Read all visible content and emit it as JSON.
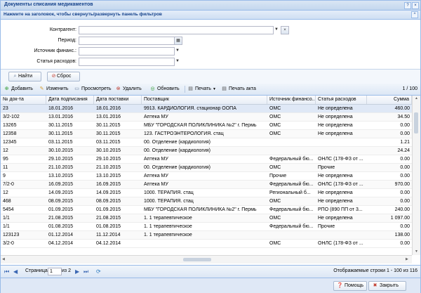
{
  "window": {
    "title": "Документы списания медикаментов",
    "btn_help": "?",
    "btn_close": "×"
  },
  "filter_panel": {
    "header": "Нажмите на заголовок, чтобы свернуть/развернуть панель фильтров",
    "collapse_icon": "^",
    "fields": [
      {
        "label": "Контрагент:",
        "value": ""
      },
      {
        "label": "Период:",
        "value": ""
      },
      {
        "label": "Источник финанс.:",
        "value": ""
      },
      {
        "label": "Статья расходов:",
        "value": ""
      }
    ]
  },
  "actions": {
    "find": "Найти",
    "reset": "Сброс"
  },
  "toolbar": {
    "add": "Добавить",
    "edit": "Изменить",
    "view": "Просмотреть",
    "delete": "Удалить",
    "refresh": "Обновить",
    "print": "Печать",
    "print_act": "Печать акта",
    "page_indicator": "1 / 100"
  },
  "grid": {
    "columns": [
      "№ док-та",
      "Дата подписания",
      "Дата поставки",
      "Поставщик",
      "Источник финансо...",
      "Статья расходов",
      "Сумма"
    ],
    "rows": [
      [
        "23",
        "18.01.2016",
        "18.01.2016",
        "9913. КАРДИОЛОГИЯ. стационар ООПА",
        "ОМС",
        "Не определена",
        "460.00"
      ],
      [
        "3/2-102",
        "13.01.2016",
        "13.01.2016",
        "Аптека МУ",
        "ОМС",
        "Не определена",
        "34.50"
      ],
      [
        "13265",
        "30.11.2015",
        "30.11.2015",
        "МБУ \"ГОРОДСКАЯ ПОЛИКЛИНИКА №2\" г. Пермь",
        "ОМС",
        "Не определена",
        "0.00"
      ],
      [
        "12358",
        "30.11.2015",
        "30.11.2015",
        "123. ГАСТРОЭНТЕРОЛОГИЯ. стац",
        "ОМС",
        "Не определена",
        "0.00"
      ],
      [
        "12345",
        "03.11.2015",
        "03.11.2015",
        "00. Отделение (кардиология)",
        "",
        "",
        "1.21"
      ],
      [
        "12",
        "30.10.2015",
        "30.10.2015",
        "00. Отделение (кардиология)",
        "",
        "",
        "24.24"
      ],
      [
        "95",
        "29.10.2015",
        "29.10.2015",
        "Аптека МУ",
        "Федеральный бю...",
        "ОНЛС (178-ФЗ от ...",
        "0.00"
      ],
      [
        "11",
        "21.10.2015",
        "21.10.2015",
        "00. Отделение (кардиология)",
        "ОМС",
        "Прочие",
        "0.00"
      ],
      [
        "9",
        "13.10.2015",
        "13.10.2015",
        "Аптека МУ",
        "Прочие",
        "Не определена",
        "0.00"
      ],
      [
        "7/2-0",
        "16.09.2015",
        "16.09.2015",
        "Аптека МУ",
        "Федеральный бю...",
        "ОНЛС (178-ФЗ от ...",
        "970.00"
      ],
      [
        "12",
        "14.09.2015",
        "14.09.2015",
        "1000. ТЕРАПИЯ. стац",
        "Региональный б...",
        "Не определена",
        "0.00"
      ],
      [
        "468",
        "08.09.2015",
        "08.09.2015",
        "1000. ТЕРАПИЯ. стац",
        "ОМС",
        "Не определена",
        "0.00"
      ],
      [
        "5454",
        "01.09.2015",
        "01.09.2015",
        "МБУ \"ГОРОДСКАЯ ПОЛИКЛИНИКА №2\" г. Пермь",
        "Федеральный бю...",
        "РПО (890 ПП от 3...",
        "240.00"
      ],
      [
        "1/1",
        "21.08.2015",
        "21.08.2015",
        "1. 1 терапевтическое",
        "ОМС",
        "Не определена",
        "1 097.00"
      ],
      [
        "1/1",
        "01.08.2015",
        "01.08.2015",
        "1. 1 терапевтическое",
        "Федеральный бю...",
        "Прочие",
        "0.00"
      ],
      [
        "123123",
        "01.12.2014",
        "11.12.2014",
        "1. 1 терапевтическое",
        "",
        "",
        "138.00"
      ],
      [
        "3/2-0",
        "04.12.2014",
        "04.12.2014",
        "",
        "ОМС",
        "ОНЛС (178-ФЗ от ...",
        "0.00"
      ]
    ]
  },
  "pager": {
    "page_label": "Страница",
    "page_value": "1",
    "of_label": "из 2",
    "display_info": "Отображаемые строки 1 - 100 из 116"
  },
  "footer": {
    "help": "Помощь",
    "close": "Закрыть"
  }
}
